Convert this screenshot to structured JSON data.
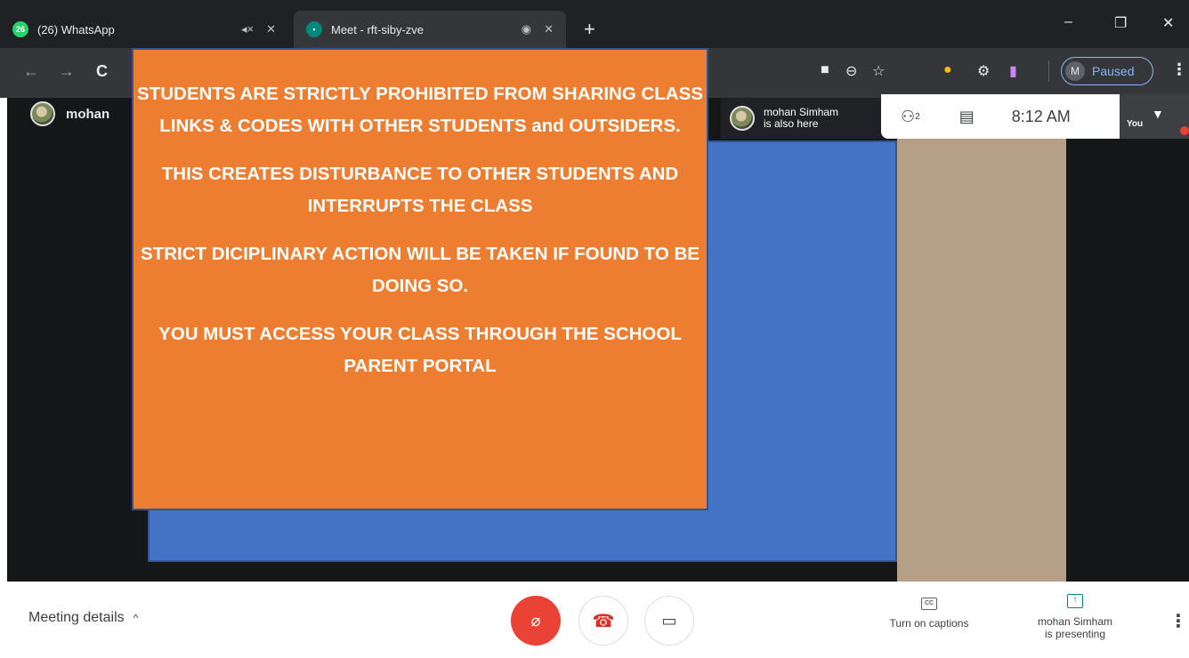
{
  "browser": {
    "tabs": [
      {
        "title": "(26) WhatsApp",
        "badge": "26",
        "state": "inactive"
      },
      {
        "title": "Meet - rft-siby-zve",
        "state": "active"
      }
    ],
    "new_tab": "+",
    "window_controls": {
      "minimize": "–",
      "restore": "❐",
      "close": "✕"
    },
    "profile": {
      "initial": "M",
      "label": "Paused"
    }
  },
  "meeting": {
    "self_name": "mohan",
    "notice": {
      "lines": [
        "STUDENTS ARE STRICTLY PROHIBITED FROM SHARING CLASS LINKS & CODES WITH OTHER STUDENTS and OUTSIDERS.",
        "THIS CREATES DISTURBANCE TO OTHER STUDENTS AND INTERRUPTS THE CLASS",
        "STRICT DICIPLINARY ACTION WILL BE TAKEN IF FOUND TO BE DOING SO.",
        "YOU MUST ACCESS YOUR CLASS THROUGH THE SCHOOL PARENT PORTAL"
      ]
    },
    "join_notice": {
      "name": "mohan Simham",
      "text": "is also here"
    },
    "info_bar": {
      "participants_count": "2",
      "time": "8:12 AM"
    },
    "self_preview_label": "You"
  },
  "controls": {
    "meeting_details": "Meeting details",
    "captions_label": "Turn on captions",
    "cc_text": "CC",
    "presenting_name": "mohan Simham",
    "presenting_text": "is presenting",
    "more_icon": "⋮"
  },
  "colors": {
    "notice_orange": "#ed7d31",
    "slide_blue": "#4472c4",
    "mic_off_red": "#ea4335",
    "hangup_red": "#d93025",
    "teal": "#00897b"
  }
}
